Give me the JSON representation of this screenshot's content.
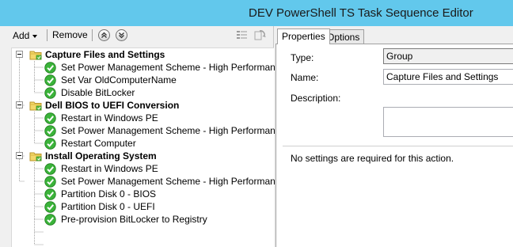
{
  "window": {
    "title": "DEV PowerShell TS Task Sequence Editor"
  },
  "toolbar": {
    "add_label": "Add",
    "remove_label": "Remove"
  },
  "tree": {
    "groups": [
      {
        "label": "Capture Files and Settings",
        "steps": [
          "Set Power Management Scheme - High Performance",
          "Set Var OldComputerName",
          "Disable BitLocker"
        ]
      },
      {
        "label": "Dell BIOS to UEFI Conversion",
        "steps": [
          "Restart in Windows PE",
          "Set Power Management Scheme - High Performance",
          "Restart Computer"
        ]
      },
      {
        "label": "Install Operating System",
        "steps": [
          "Restart in Windows PE",
          "Set Power Management Scheme - High Performance",
          "Partition Disk 0 - BIOS",
          "Partition Disk 0 - UEFI",
          "Pre-provision BitLocker to Registry"
        ]
      }
    ]
  },
  "tabs": {
    "properties": "Properties",
    "options": "Options"
  },
  "properties": {
    "type_label": "Type:",
    "type_value": "Group",
    "name_label": "Name:",
    "name_value": "Capture Files and Settings",
    "description_label": "Description:",
    "description_value": "",
    "note": "No settings are required  for this action."
  },
  "colors": {
    "titlebar": "#62c8ec",
    "check": "#2fa52c",
    "folder": "#e8c64a"
  }
}
